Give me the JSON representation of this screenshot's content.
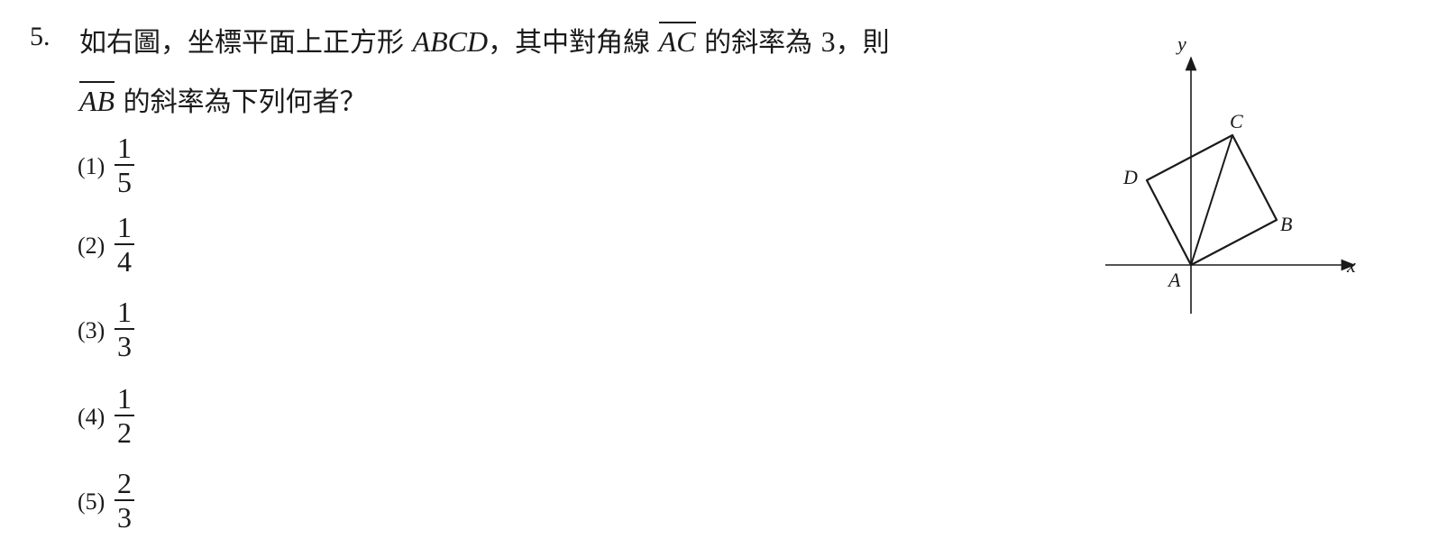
{
  "question": {
    "number": "5.",
    "line1_a": "如右圖，坐標平面上正方形 ",
    "line1_abcd": "ABCD",
    "line1_b": "，其中對角線 ",
    "line1_ac": "AC",
    "line1_c": " 的斜率為 ",
    "line1_slope": "3",
    "line1_d": "，則",
    "line2_ab": "AB",
    "line2_a": " 的斜率為下列何者？"
  },
  "options": [
    {
      "label": "(1)",
      "numerator": "1",
      "denominator": "5"
    },
    {
      "label": "(2)",
      "numerator": "1",
      "denominator": "4"
    },
    {
      "label": "(3)",
      "numerator": "1",
      "denominator": "3"
    },
    {
      "label": "(4)",
      "numerator": "1",
      "denominator": "2"
    },
    {
      "label": "(5)",
      "numerator": "2",
      "denominator": "3"
    }
  ],
  "figure": {
    "x_axis_label": "x",
    "y_axis_label": "y",
    "point_A": "A",
    "point_B": "B",
    "point_C": "C",
    "point_D": "D"
  }
}
